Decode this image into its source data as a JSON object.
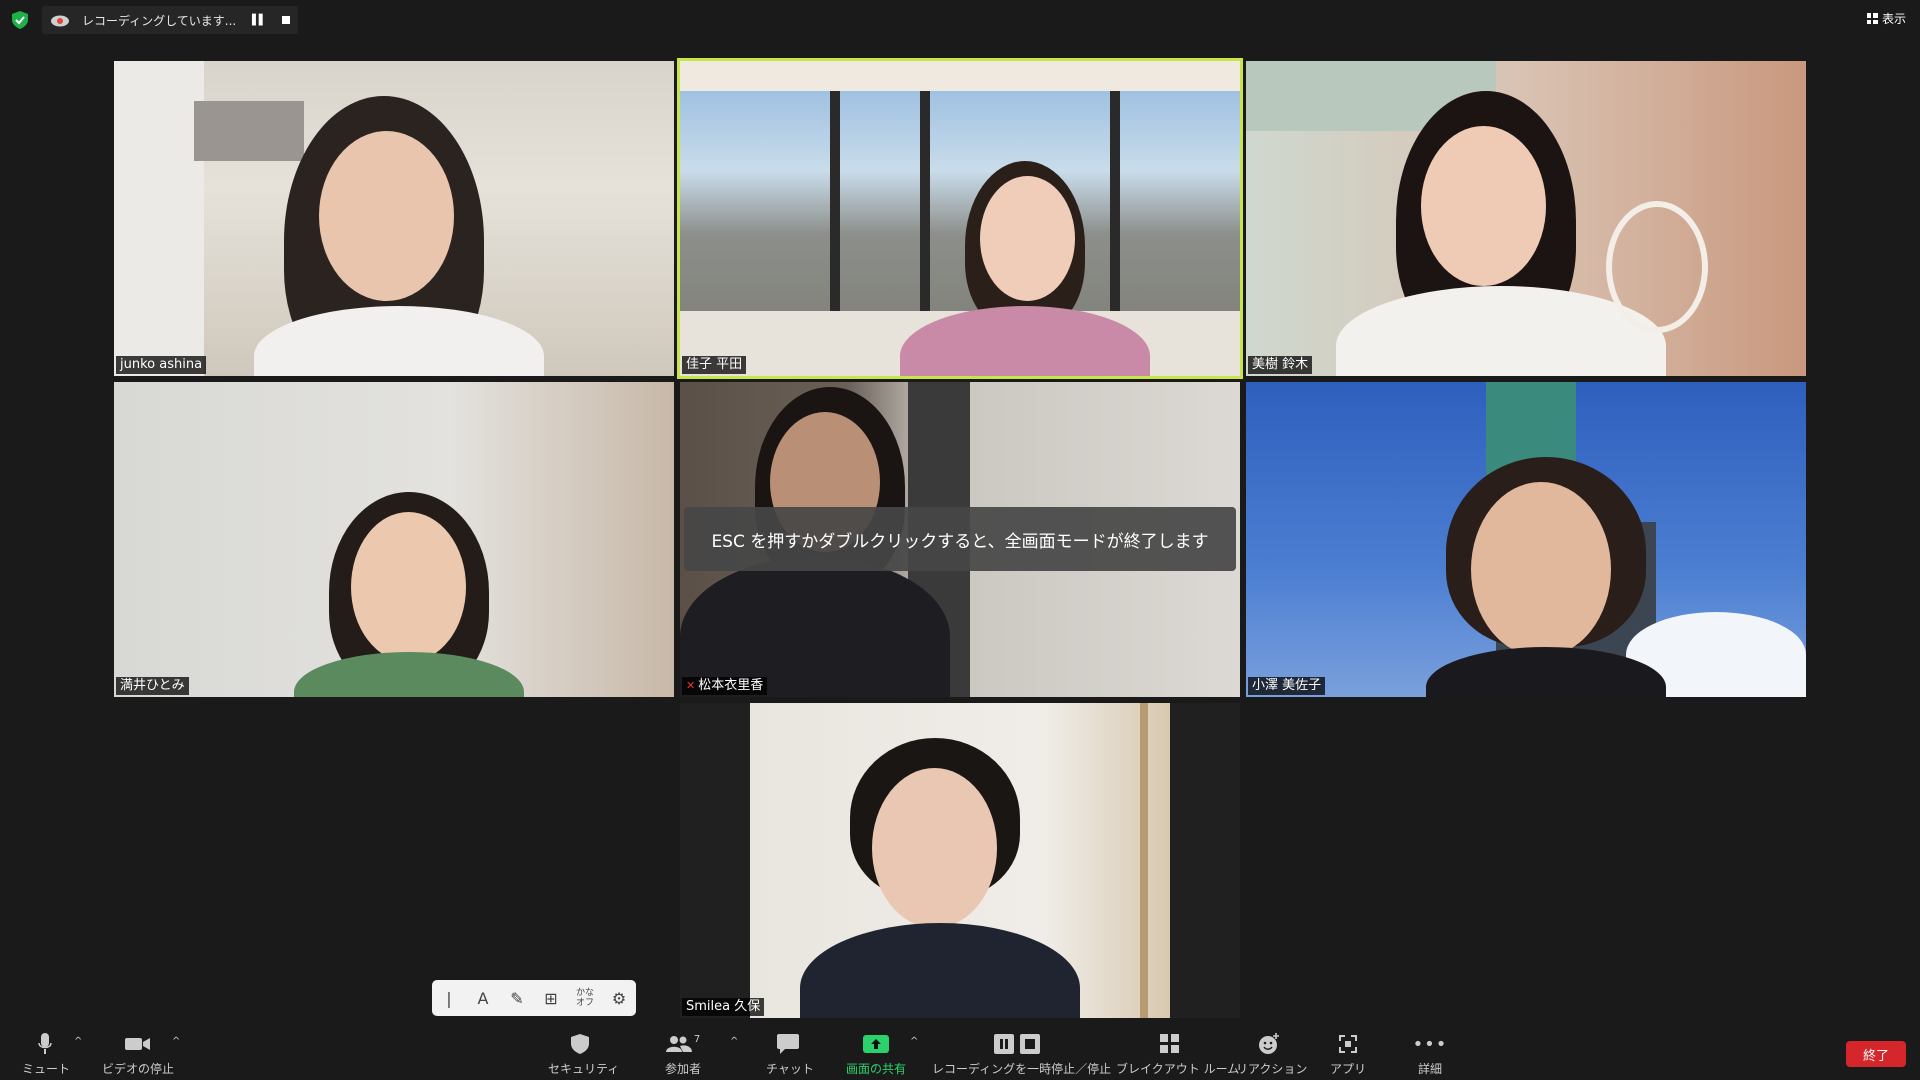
{
  "topbar": {
    "recording_label": "レコーディングしています...",
    "view_label": "表示"
  },
  "participants": [
    {
      "name": "junko ashina"
    },
    {
      "name": "佳子 平田"
    },
    {
      "name": "美樹 鈴木"
    },
    {
      "name": "満井ひとみ"
    },
    {
      "name": "松本衣里香"
    },
    {
      "name": "小澤 美佐子"
    },
    {
      "name": "Smilea 久保"
    }
  ],
  "toast": {
    "text": "ESC を押すかダブルクリックすると、全画面モードが終了します"
  },
  "mini_toolbar": {
    "kana_label_top": "かな",
    "kana_label_bottom": "オフ"
  },
  "toolbar": {
    "mute": "ミュート",
    "video": "ビデオの停止",
    "security": "セキュリティ",
    "participants": "参加者",
    "participants_count": "7",
    "chat": "チャット",
    "share": "画面の共有",
    "recording": "レコーディングを一時停止／停止",
    "breakout": "ブレイクアウト ルーム",
    "reactions": "リアクション",
    "apps": "アプリ",
    "more": "詳細",
    "end": "終了"
  },
  "colors": {
    "active_speaker": "#c8e64a",
    "share_green": "#2bd26b",
    "end_red": "#d4262b"
  }
}
